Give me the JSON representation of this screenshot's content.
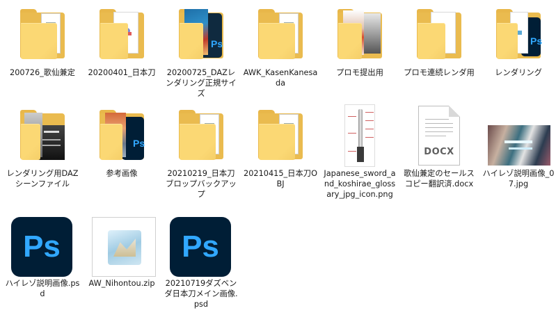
{
  "files": [
    {
      "label": "200726_歌仙兼定"
    },
    {
      "label": "20200401_日本刀"
    },
    {
      "label": "20200725_DAZレンダリング正規サイズ"
    },
    {
      "label": "AWK_KasenKanesada"
    },
    {
      "label": "プロモ提出用"
    },
    {
      "label": "プロモ連続レンダ用"
    },
    {
      "label": "レンダリング"
    },
    {
      "label": "レンダリング用DAZシーンファイル"
    },
    {
      "label": "参考画像"
    },
    {
      "label": "20210219_日本刀ブロップバックアップ"
    },
    {
      "label": "20210415_日本刀OBJ"
    },
    {
      "label": "Japanese_sword_and_koshirae_glossary_jpg_icon.png"
    },
    {
      "label": "歌仙兼定のセールスコピー翻訳済.docx"
    },
    {
      "label": "ハイレゾ説明画像_07.jpg"
    },
    {
      "label": "ハイレゾ説明画像.psd"
    },
    {
      "label": "AW_Nihontou.zip"
    },
    {
      "label": "20210719ダズベンダ日本刀メイン画像.psd"
    }
  ],
  "icons": {
    "ps_text": "Ps",
    "docx_text": "DOCX"
  },
  "colors": {
    "folder_back": "#eabb4f",
    "folder_front": "#fbd874",
    "ps_bg": "#001e36",
    "ps_fg": "#31a8ff"
  }
}
